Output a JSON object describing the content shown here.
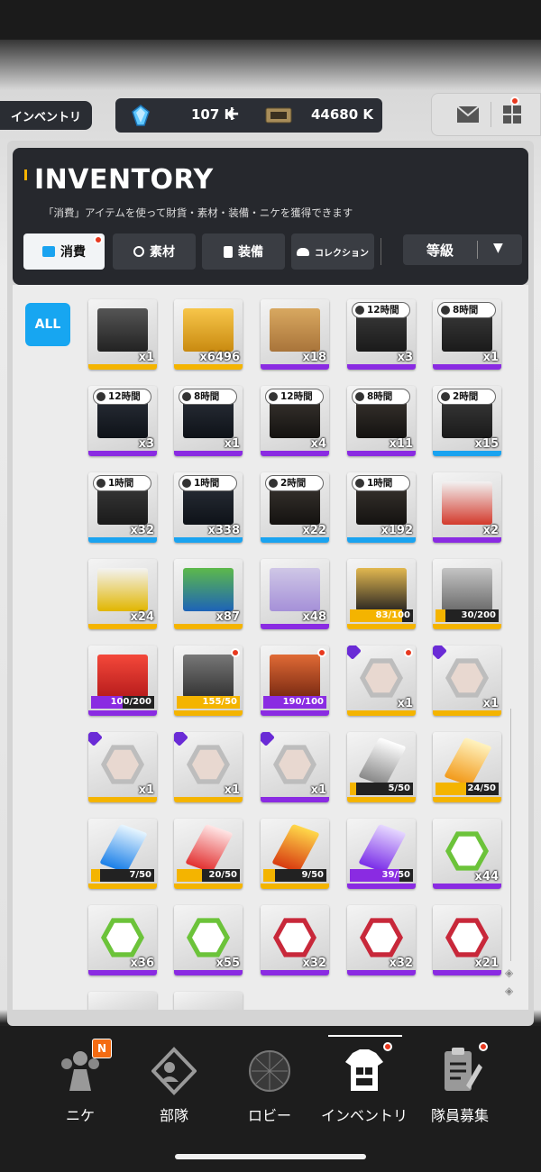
{
  "header": {
    "page_tab": "インベントリ",
    "gems": "107 K",
    "gems_plus": "+",
    "credits": "44680 K"
  },
  "inventory": {
    "title": "INVENTORY",
    "subtitle": "「消費」アイテムを使って財貨・素材・装備・ニケを獲得できます",
    "tabs": [
      {
        "label": "消費",
        "active": true,
        "dot": true
      },
      {
        "label": "素材",
        "active": false
      },
      {
        "label": "装備",
        "active": false
      },
      {
        "label": "コレクション",
        "active": false
      }
    ],
    "sort_label": "等級",
    "filter_all": "ALL"
  },
  "colors": {
    "gold": "#f4b400",
    "purple": "#8a2be2",
    "blue": "#1aa3f0",
    "red_dot": "#e8391f"
  },
  "items": [
    {
      "qty": "x1",
      "rarity": "gold",
      "art": "chest-dark"
    },
    {
      "qty": "x6496",
      "rarity": "gold",
      "art": "chest-gold"
    },
    {
      "qty": "x18",
      "rarity": "purple",
      "art": "box-cardboard"
    },
    {
      "qty": "x3",
      "rarity": "purple",
      "art": "case-red",
      "timer": "12時間"
    },
    {
      "qty": "x1",
      "rarity": "purple",
      "art": "case-red",
      "timer": "8時間"
    },
    {
      "qty": "x3",
      "rarity": "purple",
      "art": "case-blue",
      "timer": "12時間"
    },
    {
      "qty": "x1",
      "rarity": "purple",
      "art": "case-blue",
      "timer": "8時間"
    },
    {
      "qty": "x4",
      "rarity": "purple",
      "art": "case-gold",
      "timer": "12時間"
    },
    {
      "qty": "x11",
      "rarity": "purple",
      "art": "case-gold",
      "timer": "8時間"
    },
    {
      "qty": "x15",
      "rarity": "blue",
      "art": "case-red",
      "timer": "2時間"
    },
    {
      "qty": "x32",
      "rarity": "blue",
      "art": "case-red",
      "timer": "1時間"
    },
    {
      "qty": "x338",
      "rarity": "blue",
      "art": "case-blue",
      "timer": "1時間"
    },
    {
      "qty": "x22",
      "rarity": "blue",
      "art": "case-gold",
      "timer": "2時間"
    },
    {
      "qty": "x192",
      "rarity": "blue",
      "art": "case-gold",
      "timer": "1時間"
    },
    {
      "qty": "x2",
      "rarity": "purple",
      "art": "crate-white-red"
    },
    {
      "qty": "x24",
      "rarity": "gold",
      "art": "crate-white-yellow"
    },
    {
      "qty": "x87",
      "rarity": "gold",
      "art": "basket-blue"
    },
    {
      "qty": "x48",
      "rarity": "purple",
      "art": "box-tray"
    },
    {
      "progress": "83/100",
      "fill": 0.83,
      "rarity": "gold",
      "art": "chest-black-gold"
    },
    {
      "progress": "30/200",
      "fill": 0.15,
      "rarity": "gold",
      "art": "crate-grey"
    },
    {
      "progress": "100/200",
      "fill": 0.5,
      "rarity": "purple",
      "art": "box-lucky"
    },
    {
      "progress": "155/50",
      "fill": 1.0,
      "rarity": "gold",
      "art": "card-dark",
      "dot": true
    },
    {
      "progress": "190/100",
      "fill": 1.0,
      "rarity": "purple",
      "art": "crate-copper",
      "dot": true
    },
    {
      "qty": "x1",
      "rarity": "gold",
      "art": "portrait-hex",
      "badge": true,
      "dot": true
    },
    {
      "qty": "x1",
      "rarity": "gold",
      "art": "portrait-hex",
      "badge": true
    },
    {
      "qty": "x1",
      "rarity": "gold",
      "art": "portrait-hex",
      "badge": true
    },
    {
      "qty": "x1",
      "rarity": "gold",
      "art": "portrait-hex",
      "badge": true
    },
    {
      "qty": "x1",
      "rarity": "purple",
      "art": "portrait-hex",
      "badge": true
    },
    {
      "progress": "5/50",
      "fill": 0.1,
      "rarity": "gold",
      "art": "crystal-white"
    },
    {
      "progress": "24/50",
      "fill": 0.48,
      "rarity": "gold",
      "art": "crystal-gold"
    },
    {
      "progress": "7/50",
      "fill": 0.14,
      "rarity": "gold",
      "art": "crystal-blue"
    },
    {
      "progress": "20/50",
      "fill": 0.4,
      "rarity": "gold",
      "art": "crystal-red"
    },
    {
      "progress": "9/50",
      "fill": 0.18,
      "rarity": "gold",
      "art": "crystal-orange"
    },
    {
      "progress": "39/50",
      "fill": 0.78,
      "rarity": "purple",
      "art": "crystal-purple"
    },
    {
      "qty": "x44",
      "rarity": "purple",
      "art": "hex-green"
    },
    {
      "qty": "x36",
      "rarity": "purple",
      "art": "hex-green"
    },
    {
      "qty": "x55",
      "rarity": "purple",
      "art": "hex-green"
    },
    {
      "qty": "x32",
      "rarity": "purple",
      "art": "hex-red"
    },
    {
      "qty": "x32",
      "rarity": "purple",
      "art": "hex-red"
    },
    {
      "qty": "x21",
      "rarity": "purple",
      "art": "hex-red"
    },
    {
      "qty": "",
      "rarity": "none",
      "art": "partial"
    },
    {
      "qty": "",
      "rarity": "none",
      "art": "partial"
    }
  ],
  "nav": [
    {
      "label": "ニケ",
      "icon": "nikke-icon",
      "badge": "N"
    },
    {
      "label": "部隊",
      "icon": "squad-icon"
    },
    {
      "label": "ロビー",
      "icon": "lobby-icon"
    },
    {
      "label": "インベントリ",
      "icon": "inventory-icon",
      "active": true,
      "dot": true
    },
    {
      "label": "隊員募集",
      "icon": "recruit-icon",
      "dot": true
    }
  ]
}
